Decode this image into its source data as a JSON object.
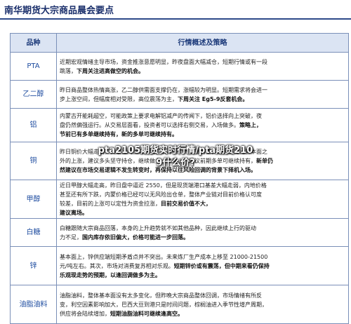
{
  "page_title": "南华期货大宗商品晨会要点",
  "table": {
    "header_name": "品种",
    "header_desc": "行情概述及策略",
    "rows": [
      {
        "name": "PTA",
        "text": "近期宏观情绪主导市场，资金推涨意愿明显，昨夜盘面大幅减仓，短期行情或有一段",
        "lines": [
          [
            "跳落，",
            "下周关注进高做空的机会。"
          ]
        ]
      },
      {
        "name": "乙二醇",
        "text": "昨日商品整体热情高涨，乙二醇供需面支撑仍在，涨幅较为明显。短期需求将会进一",
        "lines": [
          [
            "步上涨空间，但幅度相对受限，高位震荡为主，",
            "下周关注 Eg5-9反套机会。"
          ]
        ]
      },
      {
        "name": "铝",
        "text": "内蒙古开能耗超空，可能政策上要求电解铝减产的传闻下，铝价选择向上突破，夜",
        "lines": [
          [
            "盘仍然偏强运行。从交易层面看，投资者可以选择右侧交易，入场做多。",
            "策略上，"
          ],
          [
            "",
            "节前已有多单继续持有，新的多单可继续持有。"
          ]
        ]
      },
      {
        "name": "铜",
        "text": "昨日铜价大幅走高，突破区间上沿。我们认为铜价的上涨有望，在此前提出基本面之",
        "lines": [
          [
            "外的上涨，建议多头坚守持仓，继续做多。策略上，建议前期多单可继续持有，",
            "新单仍"
          ],
          [
            "",
            "然建议在市场交易逻辑不发生转变时，再保持以往风险回调的背景下择机入场。"
          ]
        ]
      },
      {
        "name": "甲醇",
        "text": "近日甲醇大幅走高，昨日盘中逼近 2550，但是现货端港口基差大幅走弱，内地价格",
        "lines": [
          [
            "甚至还有所下跌，内蒙价格已经可以无风险出仓单，整体产业链对目前价格认可度",
            ""
          ],
          [
            "较差，目前的上涨可以定性为资金拉涨，",
            "目前交易价值不大，"
          ],
          [
            "",
            "建议离场。"
          ]
        ]
      },
      {
        "name": "白糖",
        "text": "白糖跟随大宗商品回落，本身的上升趋势就不如其他品种，因此继续上行的驱动",
        "lines": [
          [
            "力不足，",
            "国内库存依旧偏大，价格可能进一步回落。"
          ]
        ]
      },
      {
        "name": "锌",
        "text": "基本面上，锌供应端短期矛盾点并不突出。未来炼厂生产成本上移至 21000-21500",
        "lines": [
          [
            "元/吨左右。其次，市场对消费复苏相对乐观。",
            "短期锌价或有震荡，但中期来看仍保持"
          ],
          [
            "",
            "乐观现走势的预期，以逢回调做多为主。"
          ]
        ]
      },
      {
        "name": "油脂油料",
        "text": "油脂油料，整体基本面没有太多变化，但昨晚大宗商品整体回调，市场情绪有所反",
        "lines": [
          [
            "变，利空因素影响加大，巴西大豆到港只是时间问题，棕榈油进入季节性增产周期，",
            ""
          ],
          [
            "供应将会陆续增加，",
            "短期油脂油料可继续逢高空。"
          ]
        ]
      }
    ]
  },
  "watermark": {
    "line1": "pta2105期货实时行情/pta期货210",
    "line2": "9什么价?"
  }
}
